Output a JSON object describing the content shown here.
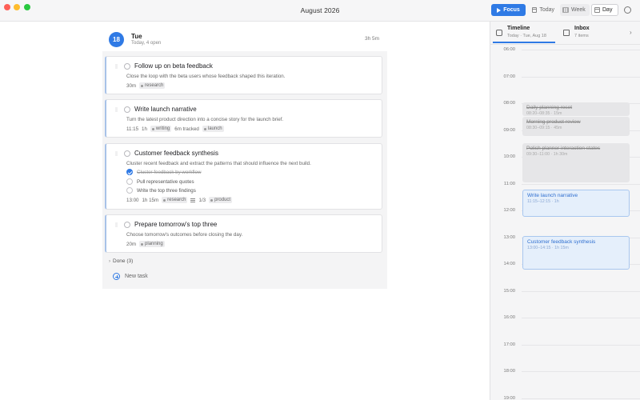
{
  "window": {
    "title": "August 2026"
  },
  "toolbar": {
    "focus_label": "Focus",
    "today_label": "Today",
    "week_label": "Week",
    "day_label": "Day"
  },
  "day": {
    "number": "18",
    "name": "Tue",
    "subtitle": "Today, 4 open",
    "total": "3h 5m"
  },
  "tasks": [
    {
      "title": "Follow up on beta feedback",
      "description": "Close the loop with the beta users whose feedback shaped this iteration.",
      "meta": [
        "30m"
      ],
      "tags": [
        "research"
      ]
    },
    {
      "title": "Write launch narrative",
      "description": "Turn the latest product direction into a concise story for the launch brief.",
      "meta": [
        "11:15",
        "1h",
        "6m tracked"
      ],
      "tags": [
        "writing",
        "launch"
      ]
    },
    {
      "title": "Customer feedback synthesis",
      "description": "Cluster recent feedback and extract the patterns that should influence the next build.",
      "subtasks": [
        {
          "label": "Cluster feedback by workflow",
          "done": true
        },
        {
          "label": "Pull representative quotes",
          "done": false
        },
        {
          "label": "Write the top three findings",
          "done": false
        }
      ],
      "meta": [
        "13:00",
        "1h 15m",
        "1/3"
      ],
      "tags": [
        "research",
        "product"
      ]
    },
    {
      "title": "Prepare tomorrow's top three",
      "description": "Choose tomorrow's outcomes before closing the day.",
      "meta": [
        "20m"
      ],
      "tags": [
        "planning"
      ]
    }
  ],
  "done_section": {
    "label": "Done (3)"
  },
  "new_task_label": "New task",
  "panel": {
    "timeline_tab": {
      "title": "Timeline",
      "subtitle": "Today · Tue, Aug 18"
    },
    "inbox_tab": {
      "title": "Inbox",
      "subtitle": "7 items"
    },
    "hours": [
      "06:00",
      "07:00",
      "08:00",
      "09:00",
      "10:00",
      "11:00",
      "12:00",
      "13:00",
      "14:00",
      "15:00",
      "16:00",
      "17:00",
      "18:00",
      "19:00"
    ],
    "events": [
      {
        "title": "Daily planning reset",
        "time": "08:20–08:35 · 15m",
        "state": "past"
      },
      {
        "title": "Morning product review",
        "time": "08:30–09:15 · 45m",
        "state": "past"
      },
      {
        "title": "Polish planner interaction states",
        "time": "09:30–11:00 · 1h 30m",
        "state": "past"
      },
      {
        "title": "Write launch narrative",
        "time": "11:15–12:15 · 1h",
        "state": "future"
      },
      {
        "title": "Customer feedback synthesis",
        "time": "13:00–14:15 · 1h 15m",
        "state": "future"
      }
    ]
  },
  "colors": {
    "accent": "#2f7ae5",
    "past_event": "#e6e6e8",
    "future_event": "#e5effb"
  },
  "icons": {
    "focus": "play-icon",
    "today": "calendar-icon",
    "week": "week-icon",
    "settings": "gear-icon",
    "timeline": "calendar-icon",
    "inbox": "inbox-icon",
    "collapse": "chevron-right-icon",
    "new_task": "plus-circle-icon"
  }
}
